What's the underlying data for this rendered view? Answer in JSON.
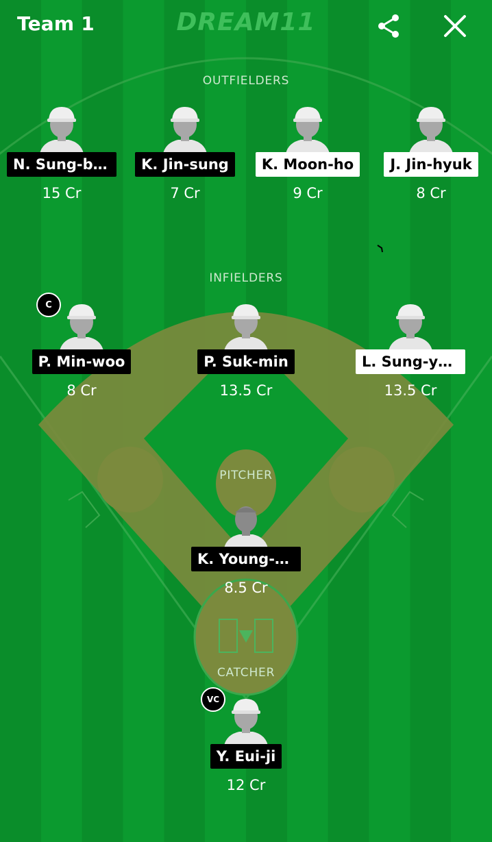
{
  "header": {
    "team_title": "Team 1",
    "logo_text": "DREAM11",
    "share_icon": "share-icon",
    "close_icon": "close-icon"
  },
  "colors": {
    "field_stripe_dark": "#0a8d2a",
    "field_stripe_light": "#0b9a2f",
    "infield_dirt": "#7a8a3e",
    "logo_green": "#3fbf5b"
  },
  "sections": {
    "outfielders": "OUTFIELDERS",
    "infielders": "INFIELDERS",
    "pitcher": "PITCHER",
    "catcher": "CATCHER"
  },
  "players": {
    "outfielders": [
      {
        "name": "N. Sung-bu...",
        "credits": "15 Cr",
        "style": "dark"
      },
      {
        "name": "K. Jin-sung",
        "credits": "7 Cr",
        "style": "dark"
      },
      {
        "name": "K. Moon-ho",
        "credits": "9 Cr",
        "style": "light"
      },
      {
        "name": "J. Jin-hyuk",
        "credits": "8 Cr",
        "style": "light"
      }
    ],
    "infielders": [
      {
        "name": "P. Min-woo",
        "credits": "8 Cr",
        "style": "dark",
        "badge": "C"
      },
      {
        "name": "P. Suk-min",
        "credits": "13.5 Cr",
        "style": "dark"
      },
      {
        "name": "L. Sung-yeol",
        "credits": "13.5 Cr",
        "style": "light"
      }
    ],
    "pitcher": {
      "name": "K. Young-gyu",
      "credits": "8.5 Cr",
      "style": "dark"
    },
    "catcher": {
      "name": "Y. Eui-ji",
      "credits": "12 Cr",
      "style": "dark",
      "badge": "VC"
    }
  }
}
